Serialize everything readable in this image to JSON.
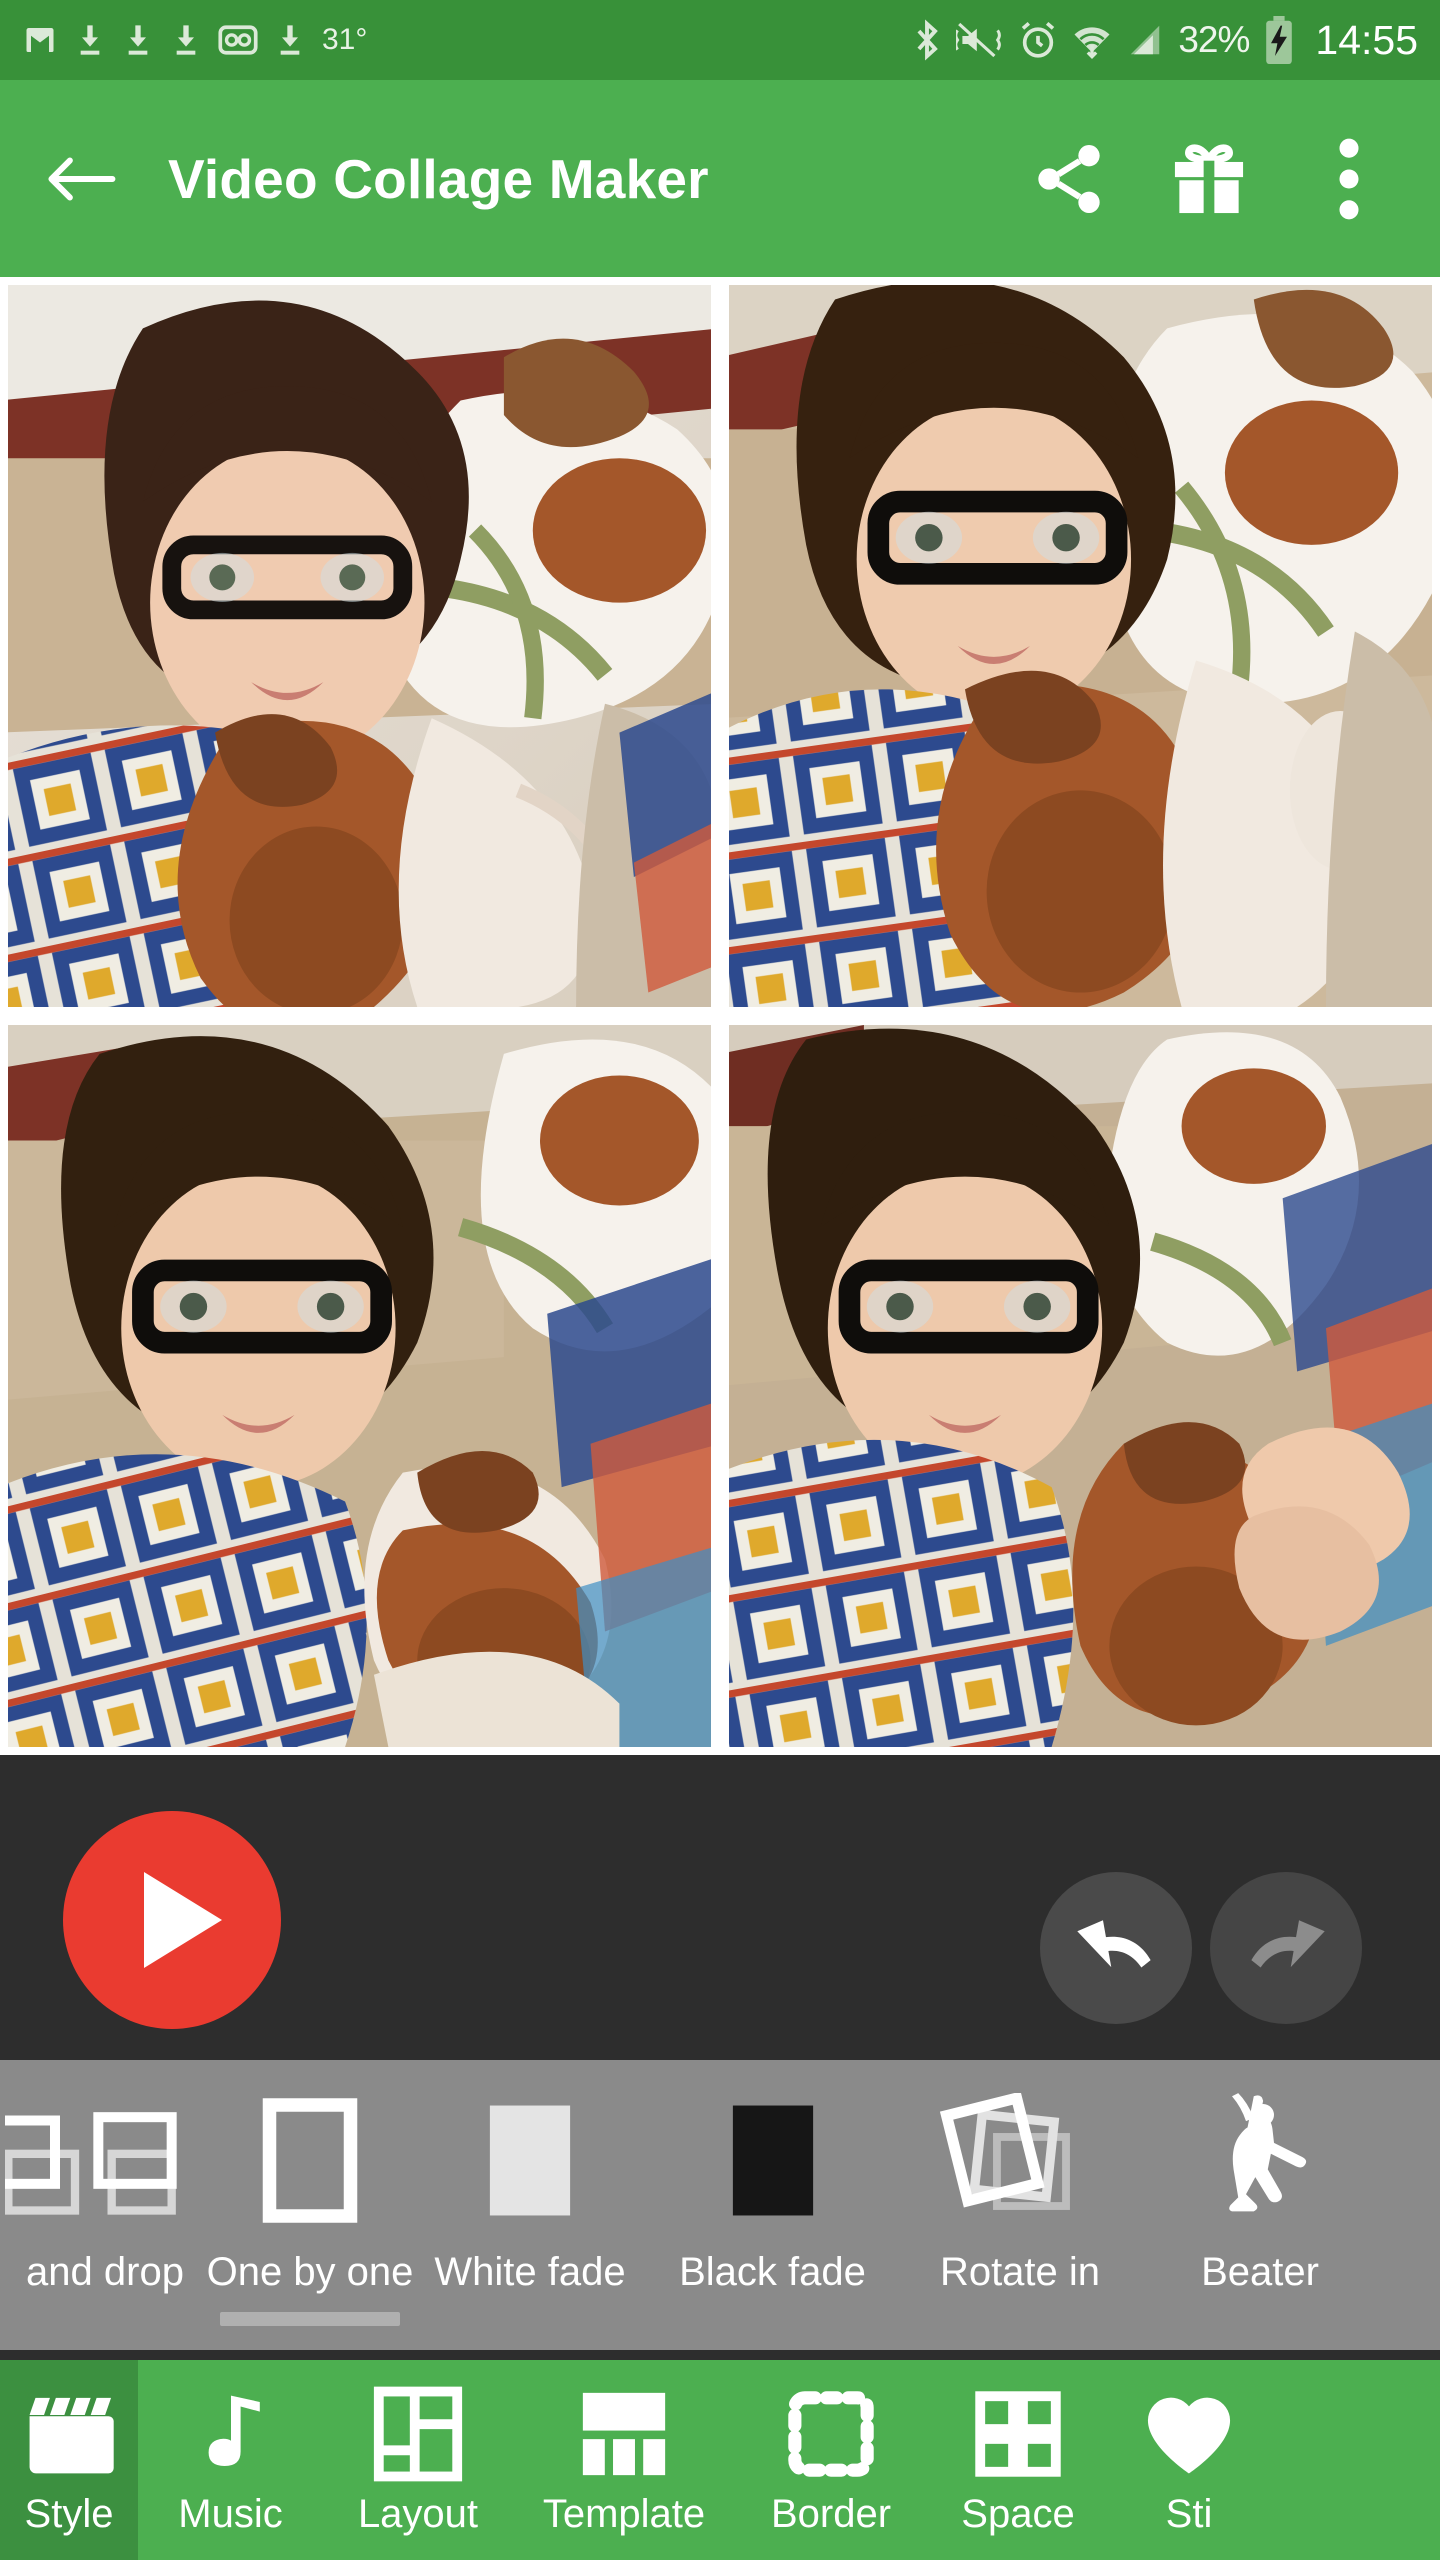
{
  "statusbar": {
    "left_icons": [
      "gmail-icon",
      "download-icon",
      "download-icon",
      "voicemail-icon",
      "download-icon"
    ],
    "temperature": "31°",
    "right_icons": [
      "bluetooth-icon",
      "mute-vibrate-icon",
      "alarm-icon",
      "wifi-icon",
      "signal-icon"
    ],
    "battery_percent": "32%",
    "battery_icon": "battery-charging-icon",
    "clock": "14:55"
  },
  "appbar": {
    "back_icon": "back-arrow-icon",
    "title": "Video Collage Maker",
    "share_icon": "share-icon",
    "gift_icon": "gift-icon",
    "overflow_icon": "overflow-menu-icon",
    "background_color": "#4caf50"
  },
  "collage": {
    "layout": "2x2-grid",
    "cells": [
      {
        "name": "collage-cell-1",
        "description": "Woman with glasses lying down with a white-brown jack russell dog on her shoulder and a brown dachshund on her chest"
      },
      {
        "name": "collage-cell-2",
        "description": "Woman with glasses looking away with jack russell dog behind and dachshund resting on her chest"
      },
      {
        "name": "collage-cell-3",
        "description": "Woman with glasses looking up with jack russell dog above her head and dachshund at her side"
      },
      {
        "name": "collage-cell-4",
        "description": "Woman with glasses holding a dachshund close with jack russell dog resting above"
      }
    ],
    "border_color": "#ffffff"
  },
  "player": {
    "play_icon": "play-icon",
    "play_color": "#ea3b30",
    "undo_icon": "undo-icon",
    "redo_icon": "redo-icon",
    "undo_enabled": true,
    "redo_enabled": false,
    "background_color": "#2d2d2d"
  },
  "transitions": {
    "selected": "One by one",
    "items": [
      {
        "label": "and drop",
        "icon": "drag-and-drop-icon",
        "selected": false
      },
      {
        "label": "One by one",
        "icon": "one-by-one-icon",
        "selected": true
      },
      {
        "label": "White fade",
        "icon": "white-fade-icon",
        "selected": false
      },
      {
        "label": "Black fade",
        "icon": "black-fade-icon",
        "selected": false
      },
      {
        "label": "Rotate in",
        "icon": "rotate-in-icon",
        "selected": false
      },
      {
        "label": "Beater",
        "icon": "beater-icon",
        "selected": false
      }
    ]
  },
  "bottomnav": {
    "active": "Style",
    "items": [
      {
        "label": "Style",
        "icon": "clapperboard-icon",
        "active": true
      },
      {
        "label": "Music",
        "icon": "music-note-icon",
        "active": false
      },
      {
        "label": "Layout",
        "icon": "layout-grid-icon",
        "active": false
      },
      {
        "label": "Template",
        "icon": "template-icon",
        "active": false
      },
      {
        "label": "Border",
        "icon": "dashed-border-icon",
        "active": false
      },
      {
        "label": "Space",
        "icon": "space-grid-icon",
        "active": false
      },
      {
        "label": "Sti",
        "icon": "sticker-heart-icon",
        "active": false
      }
    ]
  }
}
